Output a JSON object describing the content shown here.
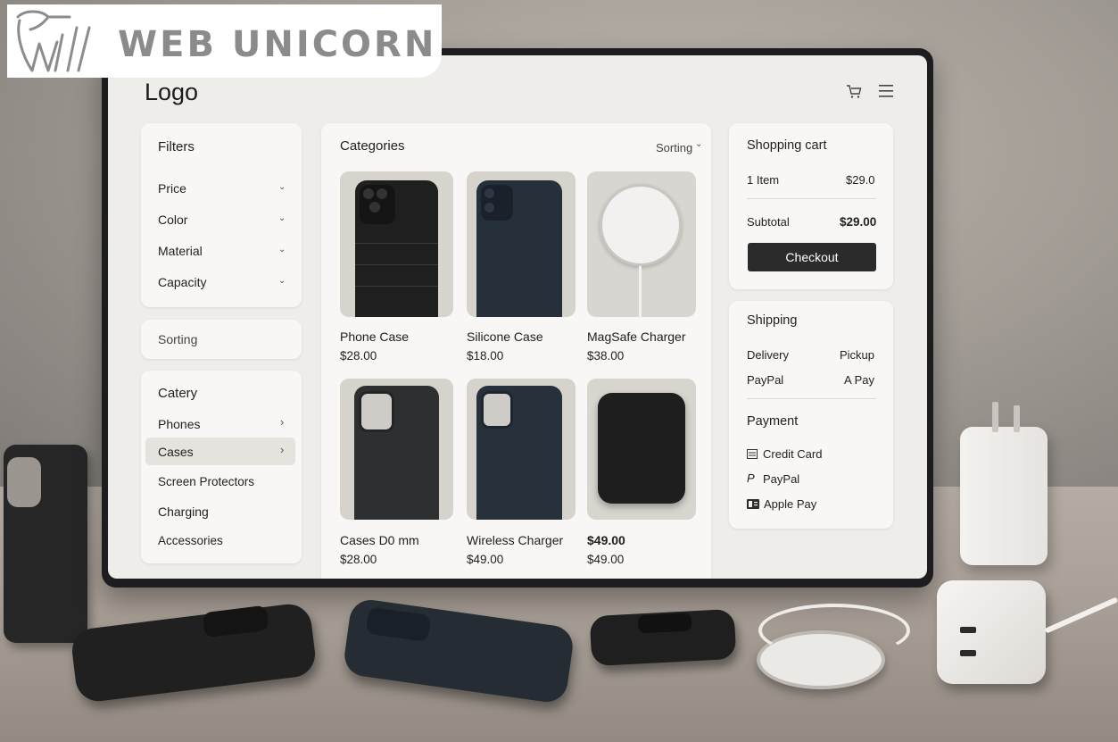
{
  "brand": {
    "name": "WEB UNICORN"
  },
  "header": {
    "logo": "Logo",
    "cart_icon": "cart-icon",
    "menu_icon": "hamburger-icon"
  },
  "filters": {
    "title": "Filters",
    "items": [
      {
        "label": "Price"
      },
      {
        "label": "Color"
      },
      {
        "label": "Material"
      },
      {
        "label": "Capacity"
      }
    ]
  },
  "sorting_box": {
    "label": "Sorting"
  },
  "category_nav": {
    "title": "Catery",
    "items": [
      {
        "label": "Phones",
        "has_arrow": true
      },
      {
        "label": "Cases",
        "has_arrow": true,
        "selected": true
      },
      {
        "label": "Screen Protectors"
      },
      {
        "label": "Charging"
      },
      {
        "label": "Accessories"
      }
    ]
  },
  "catalog": {
    "title": "Categories",
    "sort_label": "Sorting",
    "products": [
      {
        "name": "Phone Case",
        "price": "$28.00",
        "image": "black-ribbed-phone-case"
      },
      {
        "name": "Silicone Case",
        "price": "$18.00",
        "image": "navy-silicone-case"
      },
      {
        "name": "MagSafe Charger",
        "price": "$38.00",
        "image": "white-magsafe-charger"
      },
      {
        "name": "Cases D0 mm",
        "price": "$28.00",
        "image": "gray-phone-case"
      },
      {
        "name": "Wireless Charger",
        "price": "$49.00",
        "image": "navy-case"
      },
      {
        "name": "$49.00",
        "price": "$49.00",
        "image": "black-wallet"
      }
    ]
  },
  "cart": {
    "title": "Shopping cart",
    "items_label": "1 Item",
    "items_price": "$29.0",
    "subtotal_label": "Subtotal",
    "subtotal_value": "$29.00",
    "checkout_label": "Checkout"
  },
  "shipping": {
    "title": "Shipping",
    "row1_left": "Delivery",
    "row1_right": "Pickup",
    "row2_left": "PayPal",
    "row2_right": "A Pay",
    "payment_title": "Payment",
    "methods": [
      {
        "label": "Credit Card",
        "icon": "credit-card-icon"
      },
      {
        "label": "PayPal",
        "icon": "paypal-icon"
      },
      {
        "label": "Apple Pay",
        "icon": "apple-pay-icon"
      }
    ]
  },
  "colors": {
    "screen_bg": "#efede9",
    "panel_bg": "#f8f7f5",
    "checkout_bg": "#2b2b2b",
    "monitor_bezel": "#1d1d1f"
  }
}
